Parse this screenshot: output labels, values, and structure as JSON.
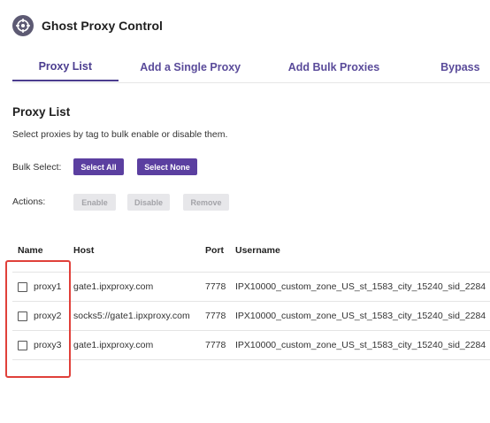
{
  "app": {
    "title": "Ghost Proxy Control",
    "logo_icon": "crosshair-icon",
    "brand_color": "#5b3fa0"
  },
  "tabs": [
    {
      "label": "Proxy List",
      "active": true
    },
    {
      "label": "Add a Single Proxy",
      "active": false
    },
    {
      "label": "Add Bulk Proxies",
      "active": false
    },
    {
      "label": "Bypass",
      "active": false
    }
  ],
  "section": {
    "title": "Proxy List",
    "description": "Select proxies by tag to bulk enable or disable them."
  },
  "bulk_select": {
    "label": "Bulk Select:",
    "select_all": "Select All",
    "select_none": "Select None"
  },
  "actions": {
    "label": "Actions:",
    "enable": "Enable",
    "disable": "Disable",
    "remove": "Remove"
  },
  "table": {
    "headers": {
      "name": "Name",
      "host": "Host",
      "port": "Port",
      "username": "Username"
    },
    "rows": [
      {
        "name": "proxy1",
        "host": "gate1.ipxproxy.com",
        "port": "7778",
        "username": "IPX10000_custom_zone_US_st_1583_city_15240_sid_2284",
        "checked": false
      },
      {
        "name": "proxy2",
        "host": "socks5://gate1.ipxproxy.com",
        "port": "7778",
        "username": "IPX10000_custom_zone_US_st_1583_city_15240_sid_2284",
        "checked": false
      },
      {
        "name": "proxy3",
        "host": "gate1.ipxproxy.com",
        "port": "7778",
        "username": "IPX10000_custom_zone_US_st_1583_city_15240_sid_2284",
        "checked": false
      }
    ]
  }
}
